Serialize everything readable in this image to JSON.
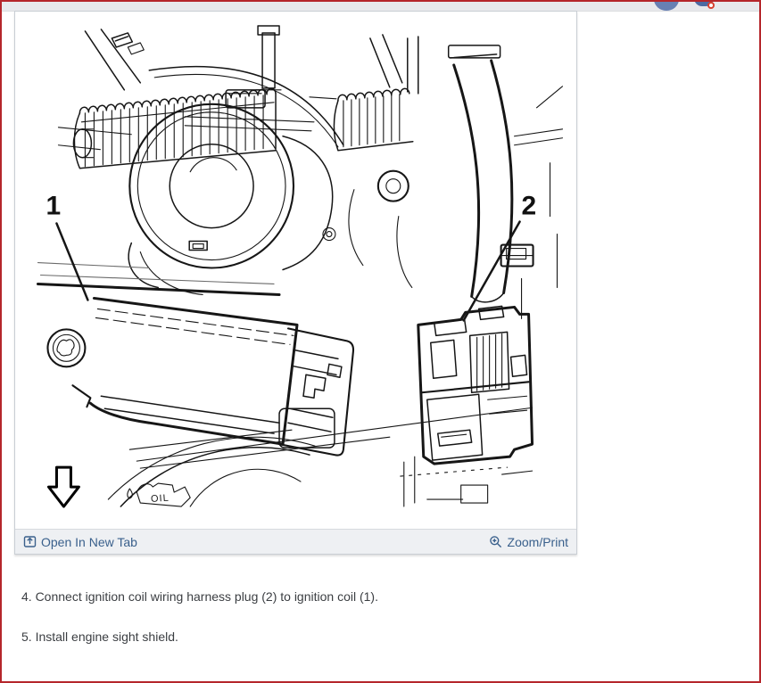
{
  "page": {
    "border_color": "#b5262b",
    "background": "#ffffff"
  },
  "topbar": {
    "icons": [
      {
        "name": "avatar-icon",
        "color": "#6780b3"
      },
      {
        "name": "notification-icon",
        "color": "#4c6ba3",
        "badge_color": "#d8402f"
      }
    ]
  },
  "figure": {
    "description": "Engine line-art: ignition coil (1) and wiring harness plug (2)",
    "callout_1": "1",
    "callout_2": "2",
    "oil_label": "OIL",
    "toolbar": {
      "open_in_new_tab": "Open In New Tab",
      "zoom_print": "Zoom/Print",
      "link_color": "#3a608c"
    }
  },
  "instructions": {
    "steps": [
      {
        "text": "4. Connect ignition coil wiring harness plug (2) to ignition coil (1)."
      },
      {
        "text": "5. Install engine sight shield."
      }
    ]
  }
}
